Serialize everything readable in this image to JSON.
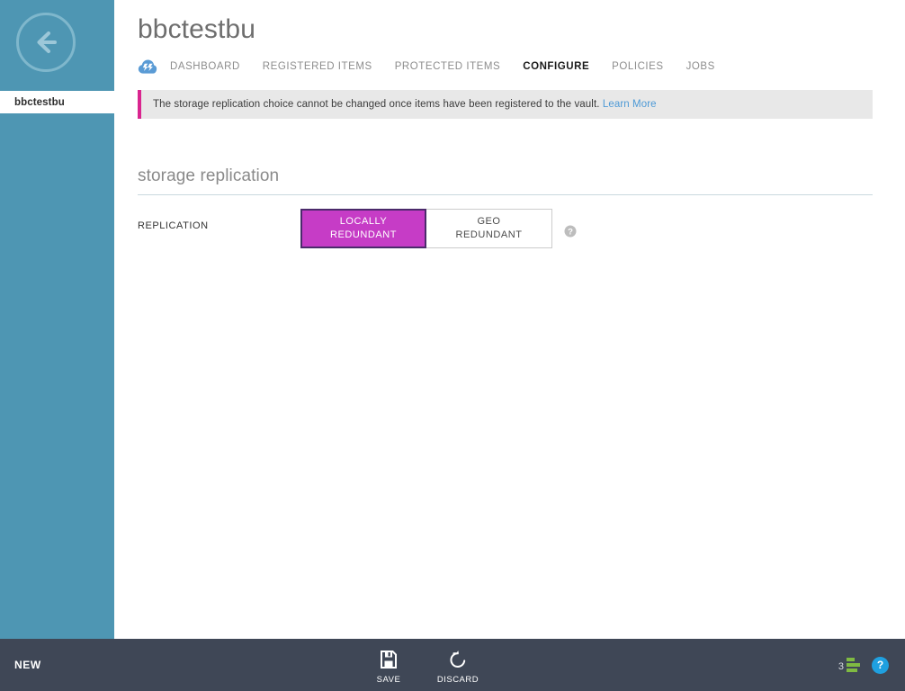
{
  "sidebar": {
    "back_icon": "back-arrow-icon",
    "selected_item": "bbctestbu"
  },
  "header": {
    "title": "bbctestbu",
    "vault_icon": "backup-vault-cloud-icon"
  },
  "tabs": [
    {
      "label": "DASHBOARD",
      "active": false
    },
    {
      "label": "REGISTERED ITEMS",
      "active": false
    },
    {
      "label": "PROTECTED ITEMS",
      "active": false
    },
    {
      "label": "CONFIGURE",
      "active": true
    },
    {
      "label": "POLICIES",
      "active": false
    },
    {
      "label": "JOBS",
      "active": false
    }
  ],
  "notice": {
    "message": "The storage replication choice cannot be changed once items have been registered to the vault.",
    "link_label": "Learn More",
    "accent_color": "#D9258F",
    "background_color": "#E8E8E8"
  },
  "section": {
    "title": "storage replication"
  },
  "replication": {
    "label": "REPLICATION",
    "options": [
      {
        "line1": "LOCALLY",
        "line2": "REDUNDANT",
        "selected": true
      },
      {
        "line1": "GEO",
        "line2": "REDUNDANT",
        "selected": false
      }
    ],
    "help_icon": "help-question-icon",
    "selected_color": "#C63CC6",
    "selected_border_color": "#4B2A6B"
  },
  "bottombar": {
    "new_label": "NEW",
    "commands": [
      {
        "label": "SAVE",
        "icon": "save-floppy-icon"
      },
      {
        "label": "DISCARD",
        "icon": "discard-undo-icon"
      }
    ],
    "usage_count": "3",
    "usage_icon": "usage-bars-icon",
    "help_icon": "help-question-icon",
    "background_color": "#3F4756",
    "accent_color": "#7FBA42"
  }
}
